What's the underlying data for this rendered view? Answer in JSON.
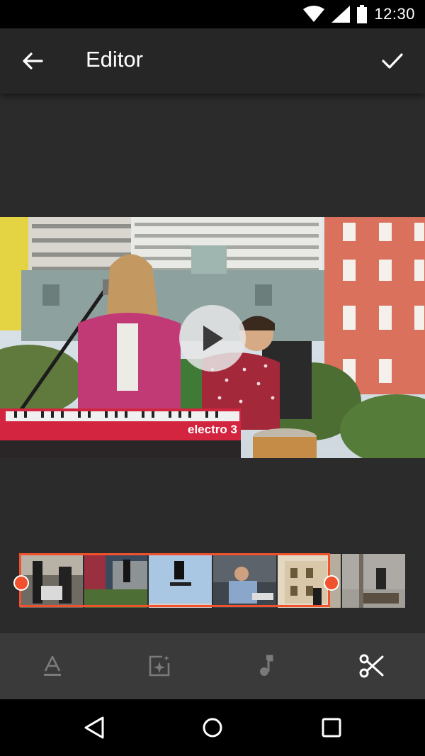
{
  "status_bar": {
    "time": "12:30",
    "icons": [
      "wifi-icon",
      "cell-signal-icon",
      "battery-icon"
    ]
  },
  "app_bar": {
    "title": "Editor",
    "back_icon": "arrow-back-icon",
    "confirm_icon": "check-icon"
  },
  "preview": {
    "keyboard_brand": "electro 3",
    "play_icon": "play-icon"
  },
  "timeline": {
    "thumbnails": [
      "clip-1",
      "clip-2",
      "clip-3",
      "clip-4",
      "clip-5",
      "clip-6"
    ],
    "accent": "#f2512d"
  },
  "toolbar": {
    "tools": [
      {
        "name": "text",
        "icon": "text-icon"
      },
      {
        "name": "sticker",
        "icon": "sparkle-image-icon"
      },
      {
        "name": "music",
        "icon": "music-note-icon"
      },
      {
        "name": "trim",
        "icon": "scissors-icon"
      }
    ]
  },
  "nav_bar": {
    "icons": [
      "back-triangle-icon",
      "home-circle-icon",
      "recents-square-icon"
    ]
  }
}
